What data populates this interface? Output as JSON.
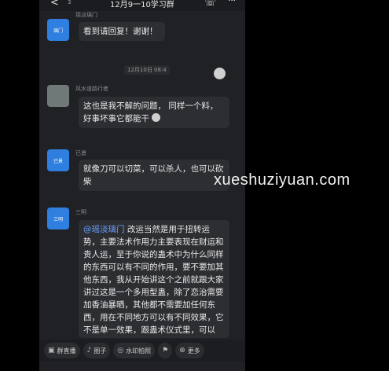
{
  "header": {
    "back_icon": "chevron-left-icon",
    "unread_count": "3",
    "title": "12月9一10学习群",
    "call_icon": "phone-icon",
    "more_icon": "ellipsis-icon"
  },
  "messages": [
    {
      "sender": "瑶淡璃门",
      "avatar_text": "璃门",
      "text": "看到请回复！谢谢！"
    },
    {
      "timestamp": "12月10日 08:4"
    },
    {
      "sender": "风水道路行者",
      "text": "这也是我不解的问题，  同样一个料，好事坏事它都能干"
    },
    {
      "sender": "已景",
      "avatar_text": "已景",
      "text": "就像刀可以切菜，可以杀人，也可以砍柴"
    },
    {
      "sender": "三明",
      "avatar_text": "三明",
      "mention": "@瑶淡璃门",
      "text": " 改运当然是用于扭转运势，主要法术作用力主要表现在财运和贵人运，至于你说的蛊术中为什么同样的东西可以有不同的作用，要不要加其他东西，我从开始讲这个之前就跟大家讲过这是一个多用型蛊，除了恋治需要加香油暴晒，其他都不需要加任何东西，用在不同地方可以有不同效果，它不是单一效果，跟蛊术仪式里，可以"
    }
  ],
  "toolbar": {
    "items": [
      {
        "icon": "live-icon",
        "label": "群直播"
      },
      {
        "icon": "mic-icon",
        "label": "圈子"
      },
      {
        "icon": "camera-icon",
        "label": "水印拍照"
      },
      {
        "icon": "flag-icon",
        "label": ""
      },
      {
        "icon": "more-icon",
        "label": "更多"
      }
    ]
  },
  "watermark": "xueshuziyuan.com"
}
